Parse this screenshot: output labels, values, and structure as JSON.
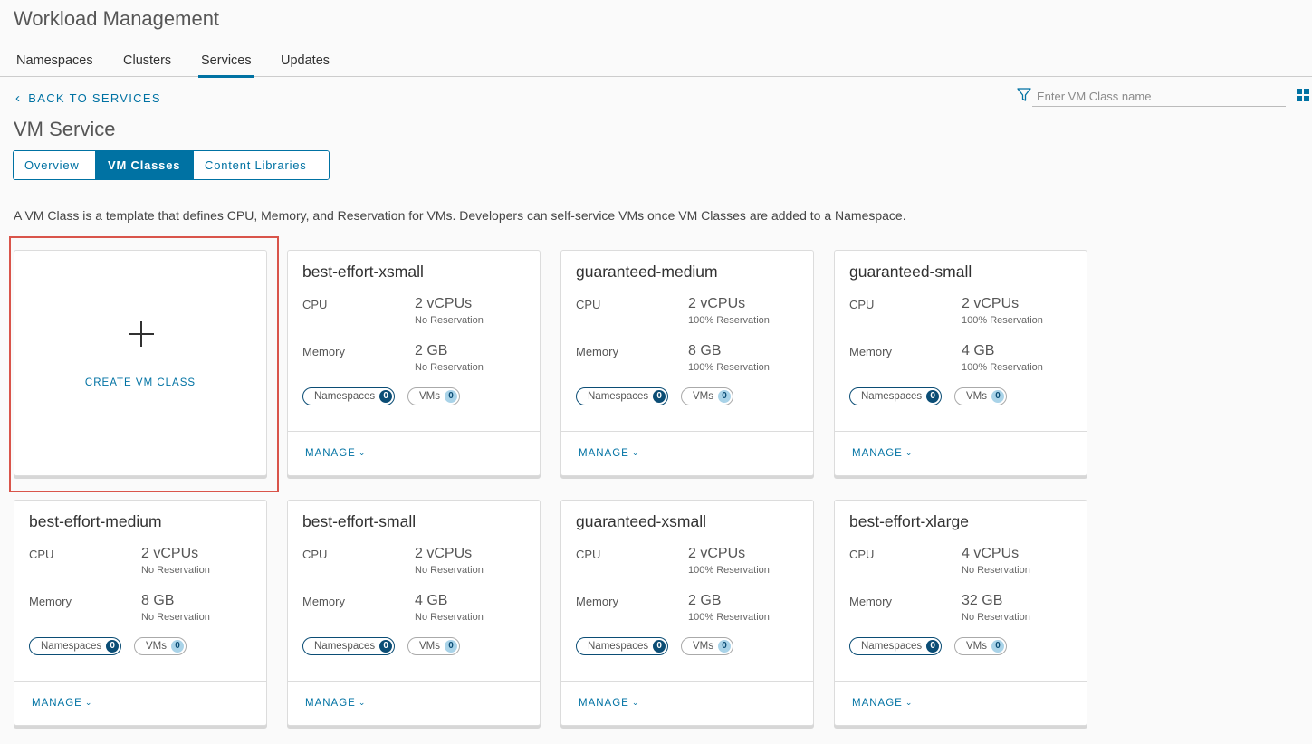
{
  "header": {
    "title": "Workload Management"
  },
  "main_tabs": [
    {
      "label": "Namespaces",
      "active": false
    },
    {
      "label": "Clusters",
      "active": false
    },
    {
      "label": "Services",
      "active": true
    },
    {
      "label": "Updates",
      "active": false
    }
  ],
  "back_link": {
    "label": "BACK TO SERVICES"
  },
  "filter": {
    "placeholder": "Enter VM Class name",
    "value": ""
  },
  "section": {
    "title": "VM Service"
  },
  "sub_tabs": [
    {
      "label": "Overview",
      "active": false
    },
    {
      "label": "VM Classes",
      "active": true
    },
    {
      "label": "Content Libraries",
      "active": false
    }
  ],
  "description": "A VM Class is a template that defines CPU, Memory, and Reservation for VMs. Developers can self-service VMs once VM Classes are added to a Namespace.",
  "create_card": {
    "label": "CREATE VM CLASS"
  },
  "labels": {
    "cpu": "CPU",
    "memory": "Memory",
    "namespaces": "Namespaces",
    "vms": "VMs",
    "manage": "MANAGE"
  },
  "cards": [
    {
      "name": "best-effort-xsmall",
      "cpu": "2 vCPUs",
      "cpu_reservation": "No Reservation",
      "memory": "2 GB",
      "memory_reservation": "No Reservation",
      "namespaces": "0",
      "vms": "0"
    },
    {
      "name": "guaranteed-medium",
      "cpu": "2 vCPUs",
      "cpu_reservation": "100% Reservation",
      "memory": "8 GB",
      "memory_reservation": "100% Reservation",
      "namespaces": "0",
      "vms": "0"
    },
    {
      "name": "guaranteed-small",
      "cpu": "2 vCPUs",
      "cpu_reservation": "100% Reservation",
      "memory": "4 GB",
      "memory_reservation": "100% Reservation",
      "namespaces": "0",
      "vms": "0"
    },
    {
      "name": "best-effort-medium",
      "cpu": "2 vCPUs",
      "cpu_reservation": "No Reservation",
      "memory": "8 GB",
      "memory_reservation": "No Reservation",
      "namespaces": "0",
      "vms": "0"
    },
    {
      "name": "best-effort-small",
      "cpu": "2 vCPUs",
      "cpu_reservation": "No Reservation",
      "memory": "4 GB",
      "memory_reservation": "No Reservation",
      "namespaces": "0",
      "vms": "0"
    },
    {
      "name": "guaranteed-xsmall",
      "cpu": "2 vCPUs",
      "cpu_reservation": "100% Reservation",
      "memory": "2 GB",
      "memory_reservation": "100% Reservation",
      "namespaces": "0",
      "vms": "0"
    },
    {
      "name": "best-effort-xlarge",
      "cpu": "4 vCPUs",
      "cpu_reservation": "No Reservation",
      "memory": "32 GB",
      "memory_reservation": "No Reservation",
      "namespaces": "0",
      "vms": "0"
    }
  ],
  "colors": {
    "accent": "#0072a3",
    "highlight": "#d9544a",
    "badge_dark": "#0b4d75"
  },
  "icons": {
    "back": "chevron-left-icon",
    "filter": "filter-icon",
    "view": "grid-view-icon",
    "create": "plus-icon",
    "manage": "chevron-down-icon"
  }
}
